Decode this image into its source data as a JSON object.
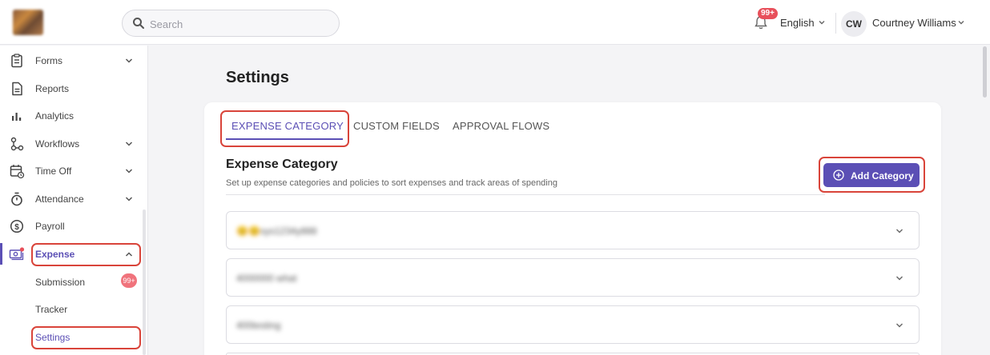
{
  "header": {
    "search_placeholder": "Search",
    "notification_badge": "99+",
    "language": "English",
    "user_initials": "CW",
    "user_name": "Courtney Williams"
  },
  "sidebar": {
    "items": [
      {
        "label": "Forms",
        "icon": "clipboard-icon",
        "expandable": true
      },
      {
        "label": "Reports",
        "icon": "document-icon",
        "expandable": false
      },
      {
        "label": "Analytics",
        "icon": "bar-chart-icon",
        "expandable": false
      },
      {
        "label": "Workflows",
        "icon": "workflow-icon",
        "expandable": true
      },
      {
        "label": "Time Off",
        "icon": "calendar-clock-icon",
        "expandable": true
      },
      {
        "label": "Attendance",
        "icon": "stopwatch-icon",
        "expandable": true
      },
      {
        "label": "Payroll",
        "icon": "dollar-circle-icon",
        "expandable": false
      },
      {
        "label": "Expense",
        "icon": "expense-icon",
        "expandable": true,
        "active": true
      }
    ],
    "sub_items": [
      {
        "label": "Submission",
        "badge": "99+"
      },
      {
        "label": "Tracker"
      },
      {
        "label": "Settings",
        "active": true
      }
    ]
  },
  "main": {
    "page_title": "Settings",
    "tabs": [
      {
        "label": "EXPENSE CATEGORY",
        "active": true
      },
      {
        "label": "CUSTOM FIELDS"
      },
      {
        "label": "APPROVAL FLOWS"
      }
    ],
    "section_title": "Expense Category",
    "section_desc": "Set up expense categories and policies to sort expenses and track areas of spending",
    "add_button_label": "Add Category",
    "categories": [
      {
        "name": "😊😊sys1234y888"
      },
      {
        "name": "4000000 what"
      },
      {
        "name": "400testing"
      }
    ]
  },
  "colors": {
    "accent": "#5b4fb5",
    "highlight": "#d9443a",
    "badge": "#e8505b"
  }
}
